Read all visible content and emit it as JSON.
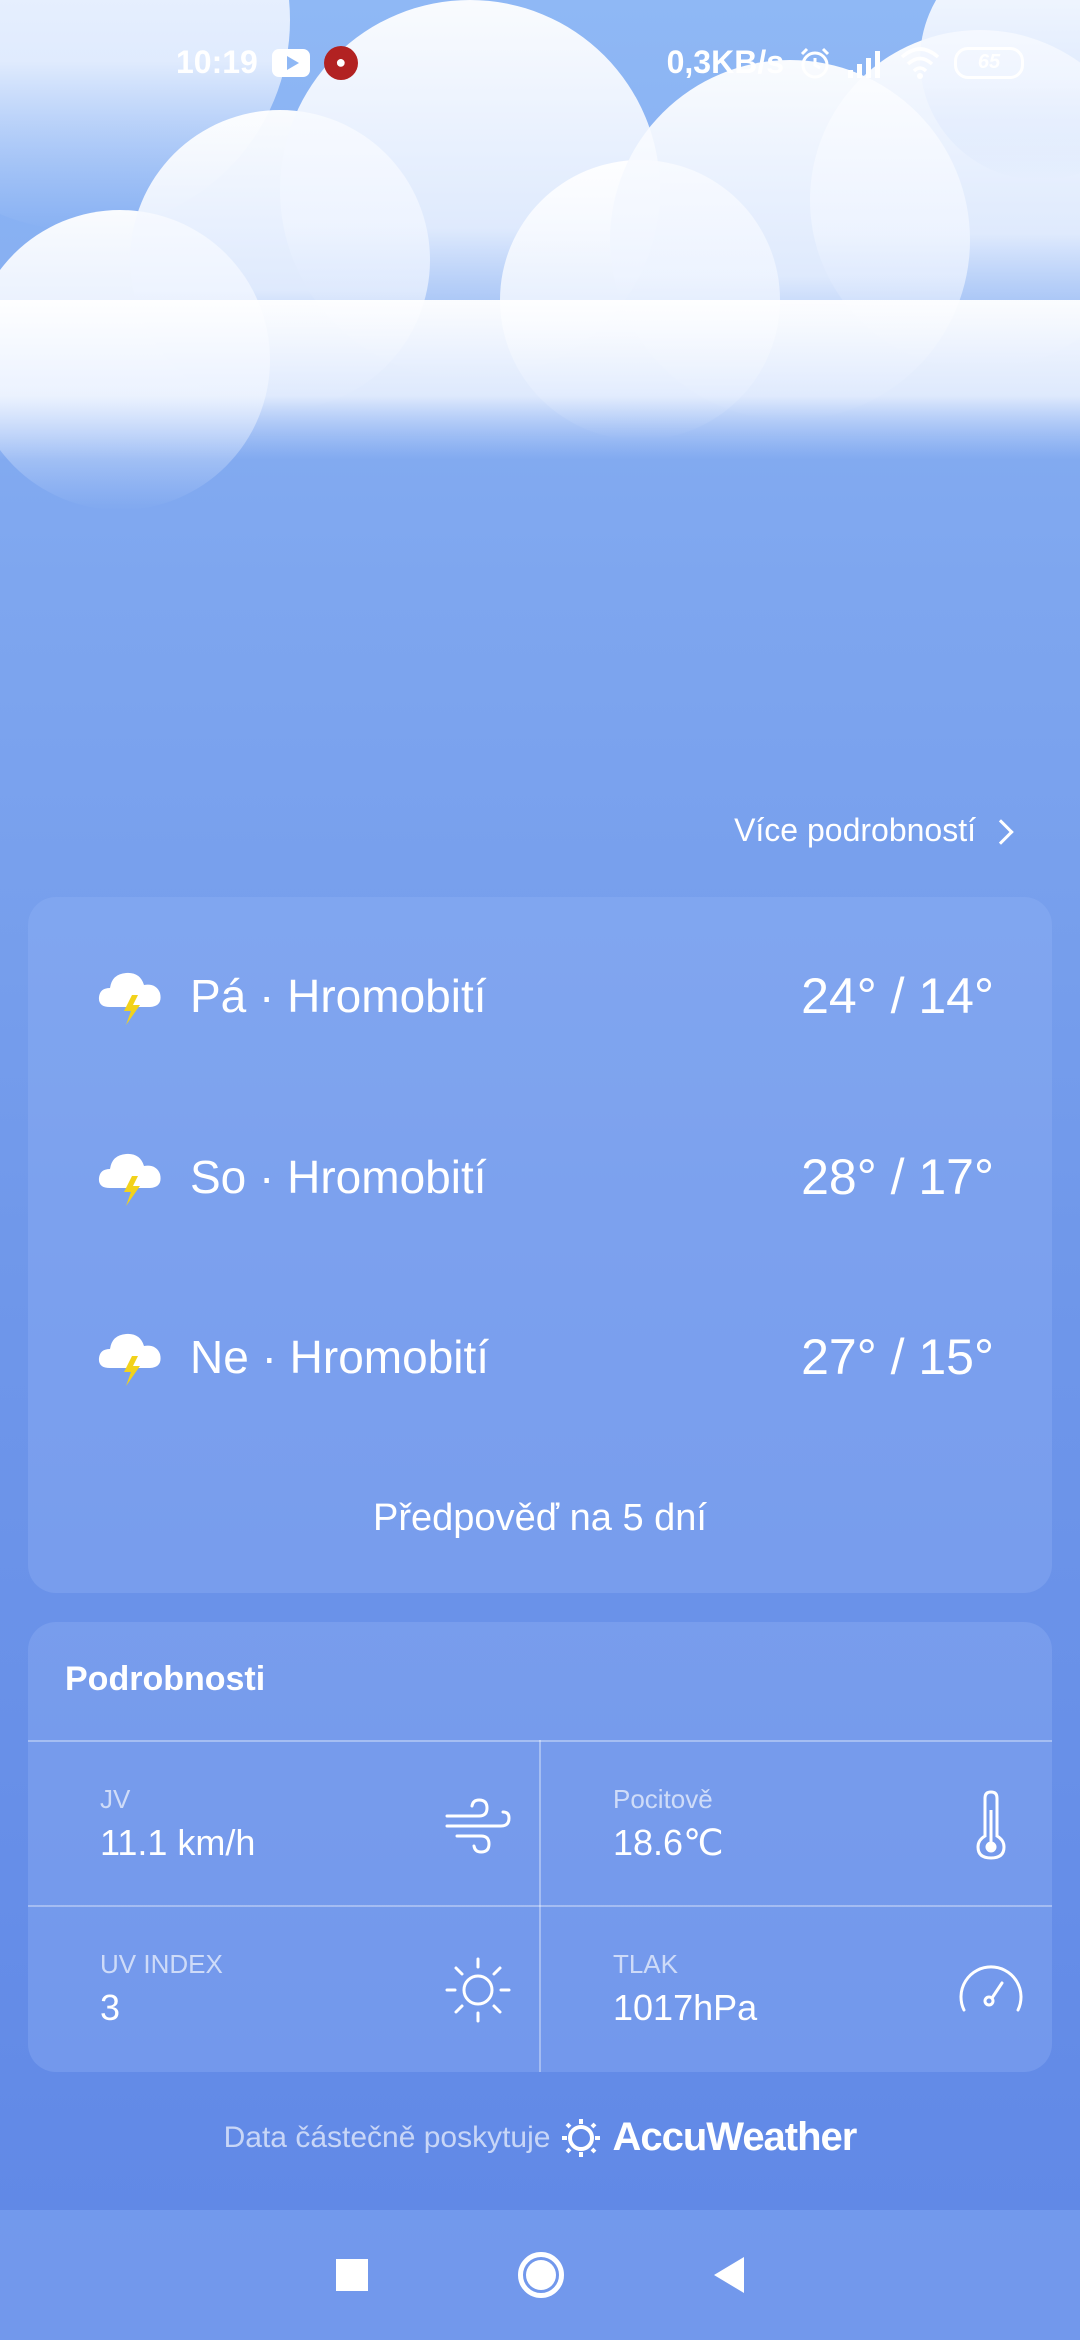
{
  "status_bar": {
    "time": "10:19",
    "network_speed": "0,3KB/s",
    "battery": "65",
    "icons": [
      "youtube-icon",
      "app-icon",
      "alarm-icon",
      "signal-icon",
      "wifi-icon",
      "battery-icon"
    ]
  },
  "more_details": {
    "label": "Více podrobností"
  },
  "forecast": {
    "days": [
      {
        "day": "Pá",
        "condition": "Hromobití",
        "label": "Pá · Hromobití",
        "temps": "24° / 14°",
        "icon": "thunderstorm-icon"
      },
      {
        "day": "So",
        "condition": "Hromobití",
        "label": "So · Hromobití",
        "temps": "28° / 17°",
        "icon": "thunderstorm-icon"
      },
      {
        "day": "Ne",
        "condition": "Hromobití",
        "label": "Ne · Hromobití",
        "temps": "27° / 15°",
        "icon": "thunderstorm-icon"
      }
    ],
    "five_day_label": "Předpověď na 5 dní"
  },
  "details": {
    "title": "Podrobnosti",
    "wind": {
      "label": "JV",
      "value": "11.1 km/h",
      "icon": "wind-icon"
    },
    "feels_like": {
      "label": "Pocitově",
      "value": "18.6℃",
      "icon": "thermometer-icon"
    },
    "uv": {
      "label": "UV INDEX",
      "value": "3",
      "icon": "sun-icon"
    },
    "pressure": {
      "label": "TLAK",
      "value": "1017hPa",
      "icon": "gauge-icon"
    }
  },
  "attribution": {
    "prefix": "Data částečně poskytuje",
    "brand": "AccuWeather"
  },
  "colors": {
    "sky_top": "#8fb8f5",
    "sky_bottom": "#5f87e6",
    "lightning": "#f2d21b"
  }
}
